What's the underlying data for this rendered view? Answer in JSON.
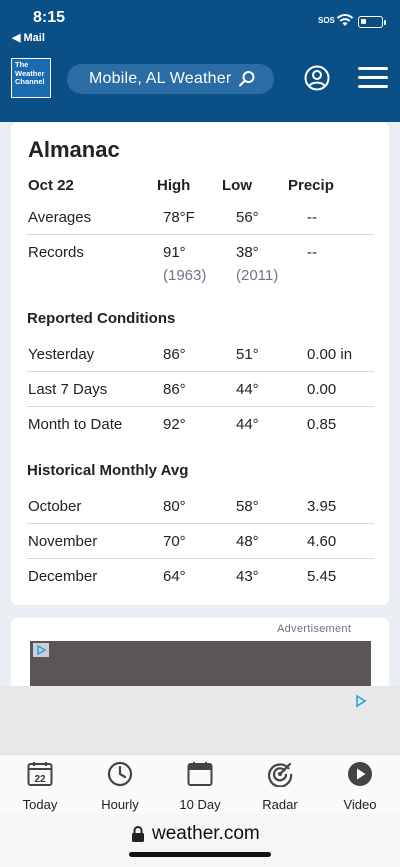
{
  "status_bar": {
    "time": "8:15",
    "back_label": "◀ Mail",
    "sos": "SOS"
  },
  "header": {
    "logo": [
      "The",
      "Weather",
      "Channel"
    ],
    "location_search": "Mobile, AL Weather",
    "search_icon": "magnifier-icon",
    "profile_icon": "user-circle-icon",
    "menu_icon": "hamburger-icon"
  },
  "almanac": {
    "title": "Almanac",
    "header": {
      "date": "Oct 22",
      "high": "High",
      "low": "Low",
      "precip": "Precip"
    },
    "averages": {
      "label": "Averages",
      "high": "78°F",
      "low": "56°",
      "precip": "--"
    },
    "records": {
      "label": "Records",
      "high": "91°",
      "high_year": "(1963)",
      "low": "38°",
      "low_year": "(2011)",
      "precip": "--"
    },
    "reported_title": "Reported Conditions",
    "reported": [
      {
        "label": "Yesterday",
        "high": "86°",
        "low": "51°",
        "precip": "0.00 in"
      },
      {
        "label": "Last 7 Days",
        "high": "86°",
        "low": "44°",
        "precip": "0.00"
      },
      {
        "label": "Month to Date",
        "high": "92°",
        "low": "44°",
        "precip": "0.85"
      }
    ],
    "historical_title": "Historical Monthly Avg",
    "historical": [
      {
        "label": "October",
        "high": "80°",
        "low": "58°",
        "precip": "3.95"
      },
      {
        "label": "November",
        "high": "70°",
        "low": "48°",
        "precip": "4.60"
      },
      {
        "label": "December",
        "high": "64°",
        "low": "43°",
        "precip": "5.45"
      }
    ]
  },
  "ad": {
    "label": "Advertisement"
  },
  "bottom_nav": [
    {
      "label": "Today",
      "icon": "calendar-day-icon",
      "day": "22"
    },
    {
      "label": "Hourly",
      "icon": "clock-icon"
    },
    {
      "label": "10 Day",
      "icon": "calendar-icon"
    },
    {
      "label": "Radar",
      "icon": "radar-icon"
    },
    {
      "label": "Video",
      "icon": "play-icon"
    }
  ],
  "browser": {
    "url": "weather.com"
  },
  "colors": {
    "header_blue": "#0a4f86",
    "search_blue": "#2b6ca4",
    "year_gray": "#6c7685"
  }
}
